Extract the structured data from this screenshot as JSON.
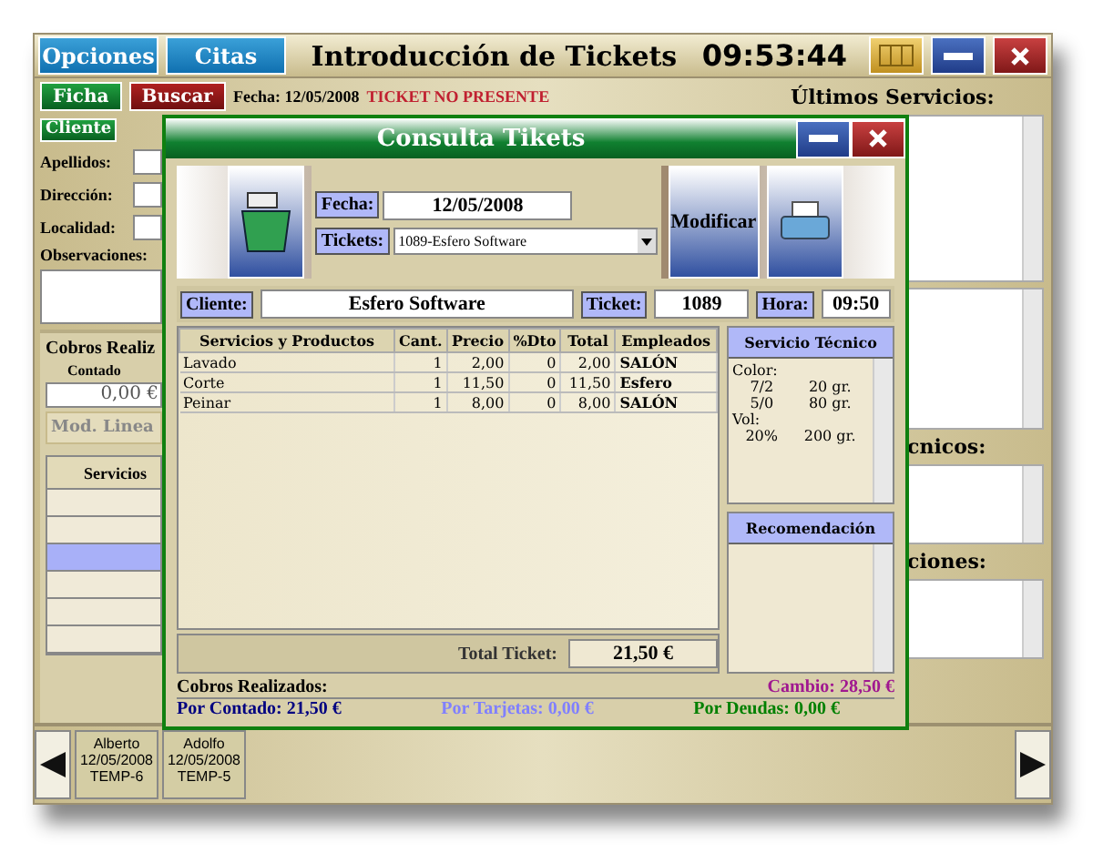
{
  "main_window": {
    "menu_buttons": [
      "Opciones",
      "Citas"
    ],
    "title": "Introducción de Tickets",
    "clock": "09:53:44"
  },
  "toolbar": {
    "buttons": [
      {
        "label": "Ficha",
        "kind": "green"
      },
      {
        "label": "Buscar",
        "kind": "red"
      }
    ],
    "date": "Fecha: 12/05/2008",
    "status": "TICKET NO PRESENTE"
  },
  "client_form": {
    "tab": "Cliente",
    "fields": [
      "Apellidos:",
      "Dirección:",
      "Localidad:"
    ],
    "notes_label": "Observaciones:"
  },
  "payments": {
    "heading": "Cobros Realiz",
    "cash_label": "Contado",
    "cash_value": "0,00 €",
    "edit_button": "Mod. Linea",
    "table_header": "Servicios",
    "rows": [
      {
        "selected": false
      },
      {
        "selected": false
      },
      {
        "selected": true
      },
      {
        "selected": false
      },
      {
        "selected": false
      },
      {
        "selected": false
      }
    ]
  },
  "right_panel": {
    "sections": [
      {
        "kind": "wide",
        "label": "Últimos Servicios:"
      },
      {
        "kind": "plain"
      },
      {
        "kind": "cut",
        "label": "cnicos:"
      },
      {
        "kind": "cut",
        "label": "ciones:"
      }
    ]
  },
  "bottom_tabs": [
    {
      "name": "Alberto",
      "date": "12/05/2008",
      "code": "TEMP-6"
    },
    {
      "name": "Adolfo",
      "date": "12/05/2008",
      "code": "TEMP-5"
    }
  ],
  "dialog": {
    "title": "Consulta Tikets",
    "date_label": "Fecha:",
    "date": "12/05/2008",
    "tickets_label": "Tickets:",
    "ticket_select": "1089-Esfero Software",
    "modify_button": "Modificar",
    "client_label": "Cliente:",
    "client": "Esfero Software",
    "ticket_label": "Ticket:",
    "ticket": "1089",
    "time_label": "Hora:",
    "time": "09:50",
    "table": {
      "columns": [
        "Servicios y Productos",
        "Cant.",
        "Precio",
        "%Dto",
        "Total",
        "Empleados"
      ],
      "rows": [
        [
          "Lavado",
          "1",
          "2,00",
          "0",
          "2,00",
          "SALÓN"
        ],
        [
          "Corte",
          "1",
          "11,50",
          "0",
          "11,50",
          "Esfero"
        ],
        [
          "Peinar",
          "1",
          "8,00",
          "0",
          "8,00",
          "SALÓN"
        ]
      ]
    },
    "technical": {
      "title": "Servicio Técnico",
      "lines": [
        {
          "kind": "label",
          "text": "Color:"
        },
        {
          "kind": "value",
          "text": "7/2",
          "amount": "20 gr."
        },
        {
          "kind": "value",
          "text": "5/0",
          "amount": "80 gr."
        },
        {
          "kind": "label",
          "text": "Vol:"
        },
        {
          "kind": "value",
          "text": "20%",
          "amount": "200 gr."
        }
      ]
    },
    "recommendation": {
      "title": "Recomendación"
    },
    "total_label": "Total Ticket:",
    "total": "21,50 €",
    "payments": {
      "title": "Cobros Realizados:",
      "change": "Cambio: 28,50 €",
      "items": [
        {
          "label": "Por Contado: 21,50 €",
          "color": "#000080"
        },
        {
          "label": "Por Tarjetas: 0,00 €",
          "color": "#8080ff"
        },
        {
          "label": "Por Deudas: 0,00 €",
          "color": "#008000"
        }
      ]
    }
  }
}
